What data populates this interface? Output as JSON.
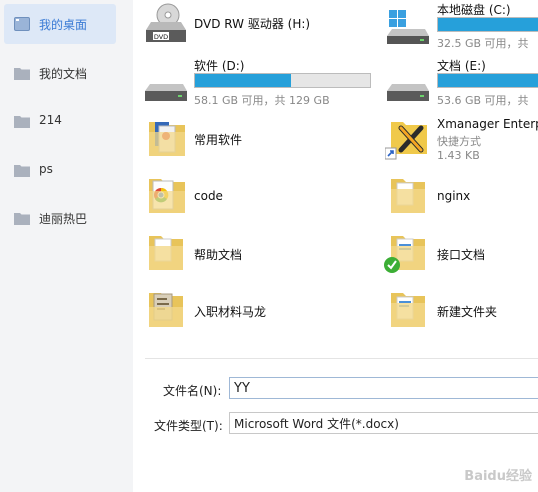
{
  "sidebar": {
    "items": [
      {
        "label": "我的桌面",
        "icon": "desktop-icon",
        "active": true
      },
      {
        "label": "我的文档",
        "icon": "folder-icon",
        "active": false
      },
      {
        "label": "214",
        "icon": "folder-icon",
        "active": false
      },
      {
        "label": "ps",
        "icon": "folder-icon",
        "active": false
      },
      {
        "label": "迪丽热巴",
        "icon": "folder-icon",
        "active": false
      }
    ]
  },
  "files": [
    {
      "name": "DVD RW 驱动器 (H:)",
      "icon": "dvd-drive-icon"
    },
    {
      "name": "本地磁盘 (C:)",
      "size": "32.5 GB 可用，共 ",
      "icon": "windows-drive-icon",
      "usage": 1.0
    },
    {
      "name": "软件 (D:)",
      "size": "58.1 GB 可用，共 129 GB",
      "icon": "hard-drive-icon",
      "usage": 0.55
    },
    {
      "name": "文档 (E:)",
      "size": "53.6 GB 可用，共 ",
      "icon": "hard-drive-icon",
      "usage": 1.0
    },
    {
      "name": "常用软件",
      "icon": "folder-icon"
    },
    {
      "name": "Xmanager Enterp",
      "type": "快捷方式",
      "size": "1.43 KB",
      "icon": "xmanager-shortcut-icon"
    },
    {
      "name": "code",
      "icon": "folder-chrome-icon"
    },
    {
      "name": "nginx",
      "icon": "folder-icon"
    },
    {
      "name": "帮助文档",
      "icon": "folder-icon"
    },
    {
      "name": "接口文档",
      "icon": "folder-check-icon"
    },
    {
      "name": "入职材料马龙",
      "icon": "folder-icon"
    },
    {
      "name": "新建文件夹",
      "icon": "folder-icon"
    }
  ],
  "form": {
    "filename_label": "文件名(N):",
    "filename_value": "YY",
    "filetype_label": "文件类型(T):",
    "filetype_value": "Microsoft Word 文件(*.docx)"
  },
  "watermark": "Baidu经验",
  "colors": {
    "accent": "#3a7bd5",
    "progress": "#26a0da",
    "sidebar": "#f3f4f6",
    "selected": "#dde8f7"
  }
}
